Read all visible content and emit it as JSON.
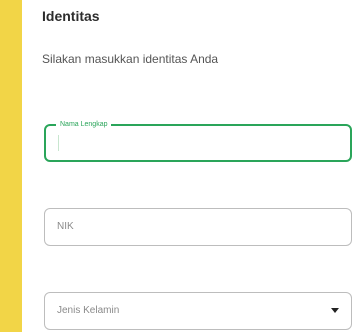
{
  "header": {
    "title": "Identitas",
    "subtitle": "Silakan masukkan identitas Anda"
  },
  "form": {
    "name_field": {
      "label": "Nama Lengkap",
      "value": ""
    },
    "nik_field": {
      "placeholder": "NIK",
      "value": ""
    },
    "gender_select": {
      "placeholder": "Jenis Kelamin",
      "icon": "chevron-down-icon"
    }
  },
  "colors": {
    "accent": "#2aa55a",
    "background_strip": "#f2d547",
    "border": "#bdbdbd"
  }
}
